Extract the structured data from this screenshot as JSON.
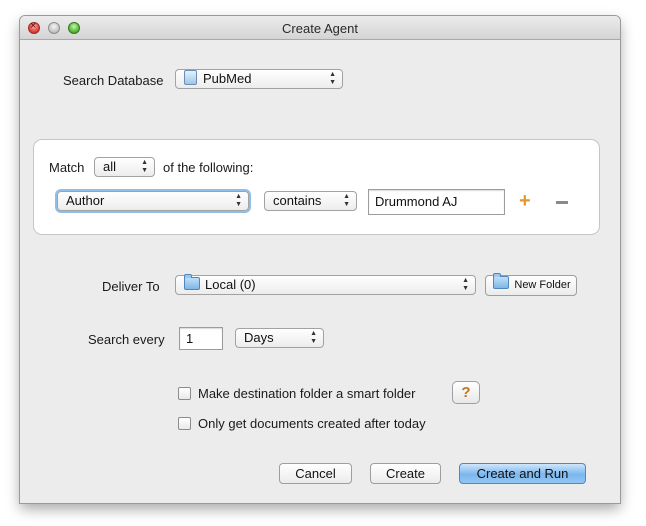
{
  "window": {
    "title": "Create Agent"
  },
  "search_database": {
    "label": "Search Database",
    "value": "PubMed",
    "icon": "database-icon"
  },
  "criteria": {
    "match_label": "Match",
    "match_value": "all",
    "following_label": "of the following:",
    "rule": {
      "field": "Author",
      "operator": "contains",
      "value": "Drummond AJ"
    },
    "add_symbol": "+"
  },
  "deliver_to": {
    "label": "Deliver To",
    "value": "Local (0)",
    "new_folder_label": "New Folder"
  },
  "search_every": {
    "label": "Search every",
    "value": "1",
    "unit": "Days"
  },
  "options": {
    "smart_folder_label": "Make destination folder a smart folder",
    "smart_folder_checked": false,
    "help_label": "?",
    "after_today_label": "Only get documents created after today",
    "after_today_checked": false
  },
  "buttons": {
    "cancel": "Cancel",
    "create": "Create",
    "create_and_run": "Create and Run"
  },
  "colors": {
    "primary_button": "#7bb7ef",
    "panel_background": "#ffffff",
    "window_background": "#ececec"
  }
}
